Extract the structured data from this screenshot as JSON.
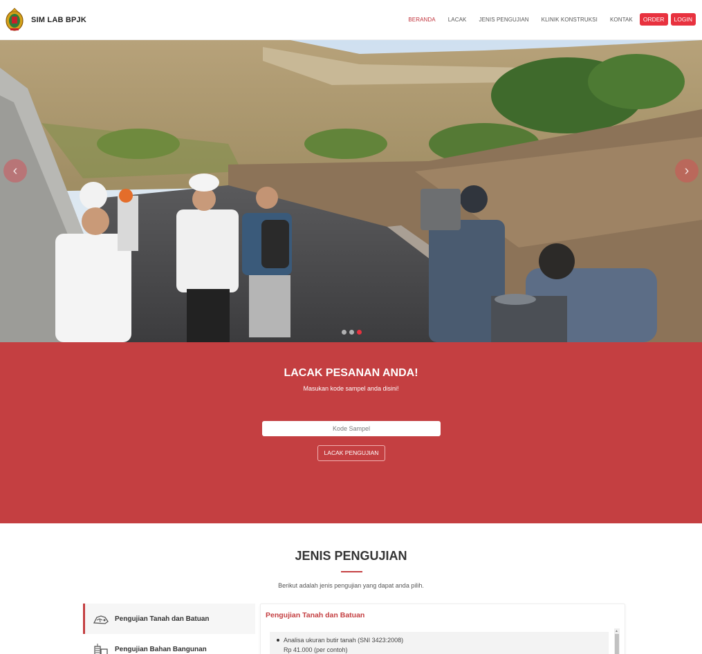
{
  "header": {
    "brand": "SIM LAB BPJK",
    "logo_icon": "emblem-icon",
    "nav": [
      {
        "label": "BERANDA",
        "active": true
      },
      {
        "label": "LACAK",
        "active": false
      },
      {
        "label": "JENIS PENGUJIAN",
        "active": false
      },
      {
        "label": "KLINIK KONSTRUKSI",
        "active": false
      },
      {
        "label": "KONTAK",
        "active": false
      }
    ],
    "order_label": "ORDER",
    "login_label": "LOGIN"
  },
  "hero": {
    "prev_icon": "chevron-left-icon",
    "next_icon": "chevron-right-icon",
    "prev_glyph": "‹",
    "next_glyph": "›",
    "slides": 3,
    "active_slide": 3
  },
  "track": {
    "title": "LACAK PESANAN ANDA!",
    "subtitle": "Masukan kode sampel anda disini!",
    "input_placeholder": "Kode Sampel",
    "input_value": "",
    "button_label": "LACAK PENGUJIAN"
  },
  "jenis": {
    "title": "JENIS PENGUJIAN",
    "subtitle": "Berikut adalah jenis pengujian yang dapat anda pilih.",
    "tabs": [
      {
        "label": "Pengujian Tanah dan Batuan",
        "icon": "soil-rock-icon",
        "active": true
      },
      {
        "label": "Pengujian Bahan Bangunan",
        "icon": "building-materials-icon",
        "active": false
      }
    ],
    "panel": {
      "title": "Pengujian Tanah dan Batuan",
      "items": [
        {
          "name": "Analisa ukuran butir tanah (SNI 3423:2008)",
          "price": "Rp 41.000 (per contoh)"
        }
      ]
    }
  },
  "colors": {
    "accent": "#c43f41",
    "button_red": "#e8323f"
  }
}
